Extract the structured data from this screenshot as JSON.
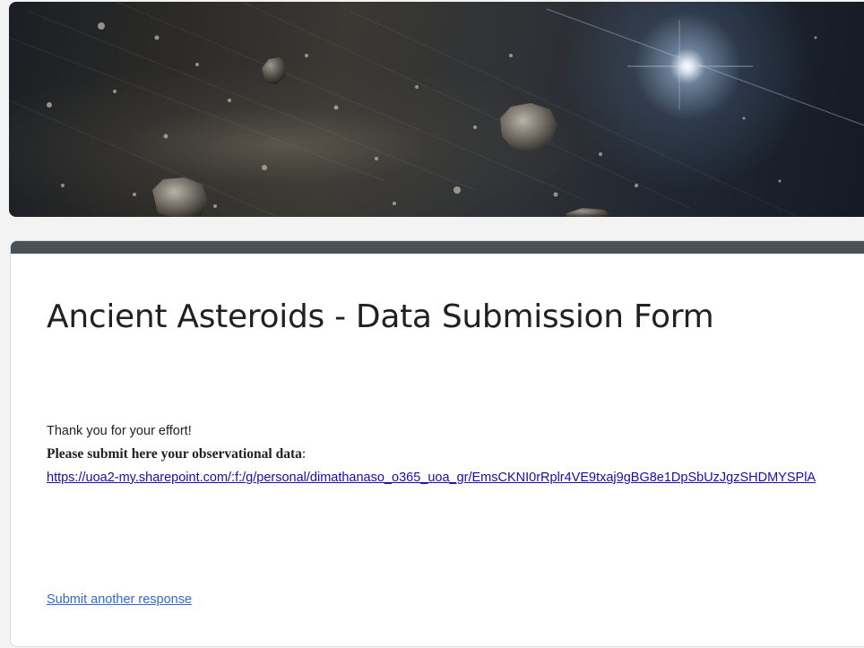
{
  "form": {
    "title": "Ancient Asteroids - Data Submission Form",
    "confirmation": {
      "thanks": "Thank you for your effort!",
      "instruction_bold": "Please submit here your observational data",
      "instruction_colon": ":",
      "link_url": "https://uoa2-my.sharepoint.com/:f:/g/personal/dimathanaso_o365_uoa_gr/EmsCKNI0rRplr4VE9txaj9gBG8e1DpSbUzJgzSHDMYSPlA"
    },
    "submit_another_label": "Submit another response"
  },
  "colors": {
    "accent_bar": "#4a5157",
    "link": "#1a0dab",
    "submit_link": "#3367d6"
  }
}
